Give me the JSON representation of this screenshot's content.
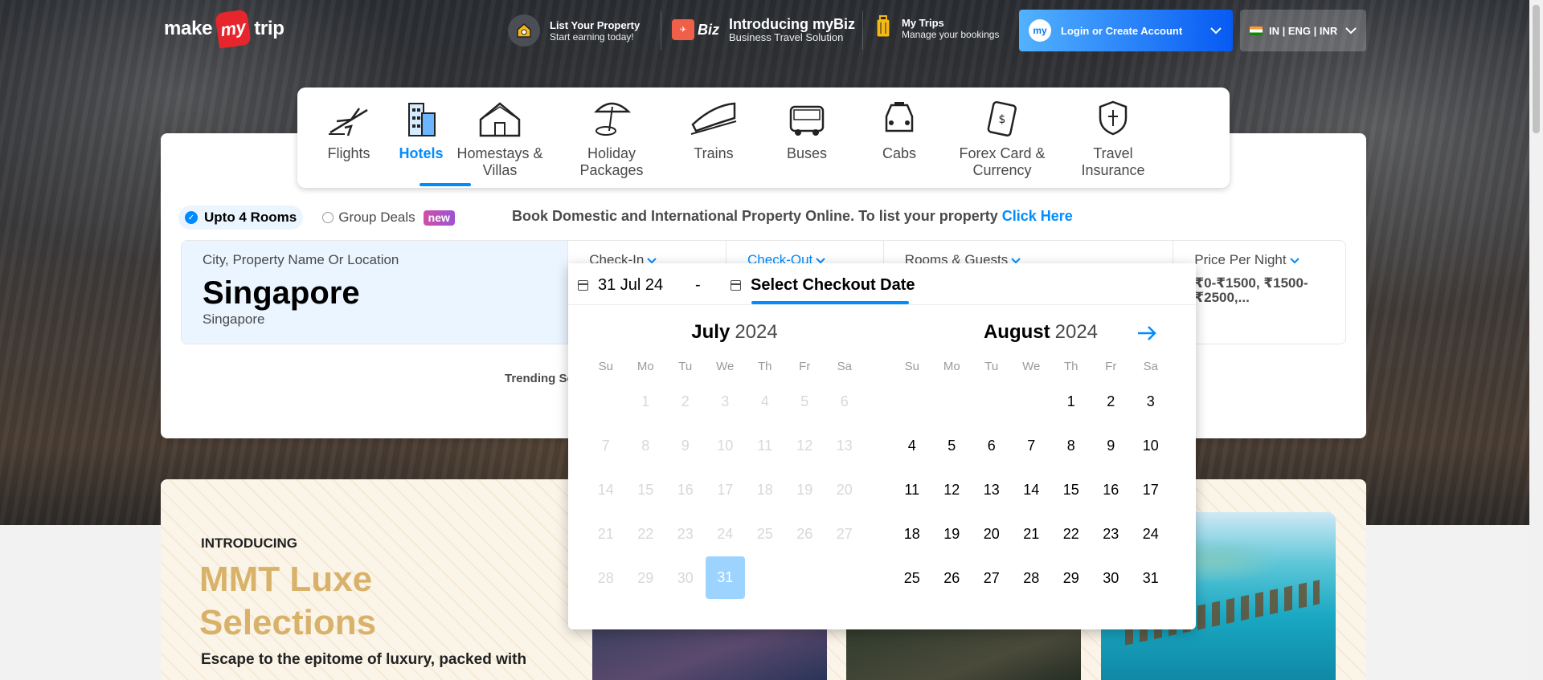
{
  "header": {
    "logo": {
      "make": "make",
      "my": "my",
      "trip": "trip"
    },
    "list_property": {
      "title": "List Your Property",
      "subtitle": "Start earning today!"
    },
    "mybiz": {
      "tag": "Biz",
      "title": "Introducing myBiz",
      "subtitle": "Business Travel Solution"
    },
    "my_trips": {
      "title": "My Trips",
      "subtitle": "Manage your bookings"
    },
    "login": {
      "label": "Login or Create Account"
    },
    "locale": {
      "label": "IN | ENG | INR"
    }
  },
  "nav": {
    "items": [
      {
        "label": "Flights",
        "icon": "flight-icon"
      },
      {
        "label": "Hotels",
        "icon": "hotel-icon",
        "active": true
      },
      {
        "label": "Homestays & Villas",
        "icon": "homestay-icon"
      },
      {
        "label": "Holiday Packages",
        "icon": "holiday-icon"
      },
      {
        "label": "Trains",
        "icon": "train-icon"
      },
      {
        "label": "Buses",
        "icon": "bus-icon"
      },
      {
        "label": "Cabs",
        "icon": "cab-icon"
      },
      {
        "label": "Forex Card & Currency",
        "icon": "forex-icon"
      },
      {
        "label": "Travel Insurance",
        "icon": "insurance-icon"
      }
    ]
  },
  "search": {
    "options": {
      "rooms": "Upto 4 Rooms",
      "group_deals": "Group Deals",
      "new_badge": "new"
    },
    "promo_text": "Book Domestic and International Property Online. To list your property",
    "promo_link": "Click Here",
    "city": {
      "label": "City, Property Name Or Location",
      "value": "Singapore",
      "sub": "Singapore"
    },
    "checkin": {
      "label": "Check-In"
    },
    "checkout": {
      "label": "Check-Out"
    },
    "guests": {
      "label": "Rooms & Guests"
    },
    "price": {
      "label": "Price Per Night",
      "value": "₹0-₹1500, ₹1500-₹2500,..."
    },
    "trending": "Trending Se"
  },
  "calendar": {
    "start_date": "31 Jul 24",
    "separator": "-",
    "end_placeholder": "Select Checkout Date",
    "weekdays": [
      "Su",
      "Mo",
      "Tu",
      "We",
      "Th",
      "Fr",
      "Sa"
    ],
    "months": [
      {
        "name": "July",
        "year": "2024",
        "offset": 1,
        "days": 31,
        "disabled_until": 30,
        "selected": 31
      },
      {
        "name": "August",
        "year": "2024",
        "offset": 4,
        "days": 31,
        "disabled_until": 0,
        "selected": null
      }
    ]
  },
  "luxe": {
    "intro": "INTRODUCING",
    "title": "MMT Luxe Selections",
    "desc": "Escape to the epitome of luxury, packed with"
  },
  "colors": {
    "accent": "#008cff",
    "selected_day": "#9cd3ff",
    "luxe_gold": "#d9b26a"
  }
}
